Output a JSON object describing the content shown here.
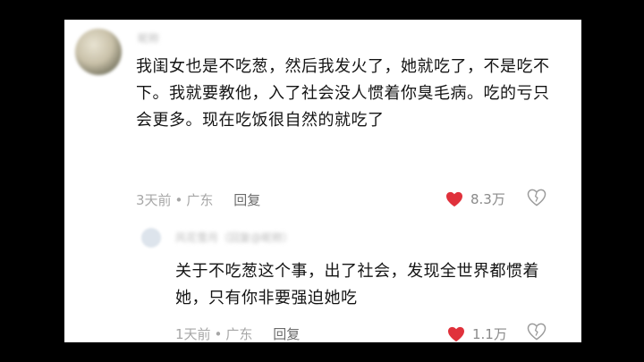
{
  "comment": {
    "author": "昵称",
    "text": "我闺女也是不吃葱，然后我发火了，她就吃了，不是吃不下。我就要教他，入了社会没人惯着你臭毛病。吃的亏只会更多。现在吃饭很自然的就吃了",
    "time": "3天前",
    "location": "广东",
    "reply_label": "回复",
    "likes": "8.3万"
  },
  "reply": {
    "author": "风花雪月（回复@昵称）",
    "text": "关于不吃葱这个事，出了社会，发现全世界都惯着她，只有你非要强迫她吃",
    "time": "1天前",
    "location": "广东",
    "reply_label": "回复",
    "likes": "1.1万"
  },
  "colors": {
    "heart": "#e0313b",
    "background": "#000000",
    "card": "#ffffff"
  },
  "icons": [
    "heart-filled-icon",
    "heart-outline-icon"
  ]
}
